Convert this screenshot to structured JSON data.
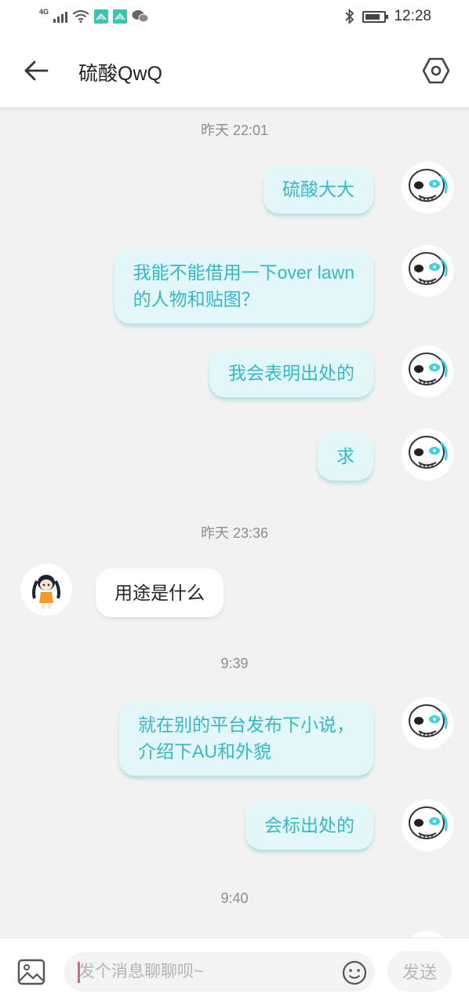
{
  "status_bar": {
    "network": "4G",
    "time": "12:28",
    "battery_level": 0.8
  },
  "header": {
    "title": "硫酸QwQ",
    "back_icon": "arrow-left-icon",
    "settings_icon": "hexagon-settings-icon"
  },
  "chat": {
    "timestamps": [
      "昨天 22:01",
      "昨天 23:36",
      "9:39",
      "9:40"
    ],
    "messages": [
      {
        "sender": "self",
        "lines": [
          "硫酸大大"
        ]
      },
      {
        "sender": "self",
        "lines": [
          "我能不能借用一下over lawn",
          "的人物和贴图？"
        ]
      },
      {
        "sender": "self",
        "lines": [
          "我会表明出处的"
        ]
      },
      {
        "sender": "self",
        "lines": [
          "求"
        ]
      },
      {
        "sender": "other",
        "lines": [
          "用途是什么"
        ]
      },
      {
        "sender": "self",
        "lines": [
          "就在别的平台发布下小说，",
          "介绍下AU和外貌"
        ]
      },
      {
        "sender": "self",
        "lines": [
          "会标出处的"
        ]
      }
    ]
  },
  "input_bar": {
    "placeholder": "发个消息聊聊呗~",
    "send_label": "发送",
    "image_icon": "image-icon",
    "emoji_icon": "smiley-icon"
  },
  "colors": {
    "accent": "#35b8c6",
    "bubble_self": "#e4f7f8",
    "background": "#f2f2f2"
  }
}
